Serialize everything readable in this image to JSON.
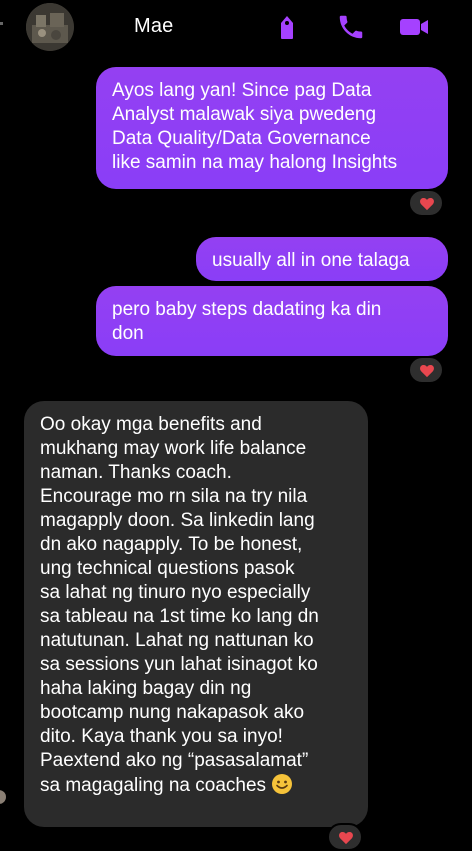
{
  "header": {
    "contact_name": "Mae",
    "icons": [
      "tag-icon",
      "phone-icon",
      "video-icon"
    ],
    "accent_color": "#a541ff"
  },
  "messages": [
    {
      "direction": "outgoing",
      "text": "Ayos lang yan! Since pag Data\nAnalyst malawak siya pwedeng\nData Quality/Data Governance\nlike samin na may halong Insights",
      "reaction": "heart"
    },
    {
      "direction": "outgoing",
      "text": "usually all in one talaga"
    },
    {
      "direction": "outgoing",
      "text": "pero baby steps dadating ka din\ndon",
      "reaction": "heart"
    },
    {
      "direction": "incoming",
      "text": "Oo okay mga benefits and\nmukhang may work life balance\nnaman. Thanks coach.\nEncourage mo rn sila na try nila\nmagapply doon. Sa linkedin lang\ndn ako nagapply. To be honest,\nung technical questions pasok\nsa lahat ng tinuro nyo especially\nsa tableau na 1st time ko lang dn\nnatutunan. Lahat ng nattunan ko\nsa sessions yun lahat isinagot ko\nhaha laking bagay din ng\nbootcamp nung nakapasok ako\ndito. Kaya thank you sa inyo!\nPaextend ako ng “pasasalamat”\nsa magagaling na coaches",
      "trailing_emoji": "smiling-face-emoji",
      "reaction": "heart"
    }
  ],
  "colors": {
    "outgoing_bubble": "#8b3df5",
    "incoming_bubble": "#2b2b2b",
    "reaction_heart": "#e8474f",
    "background": "#000000"
  }
}
